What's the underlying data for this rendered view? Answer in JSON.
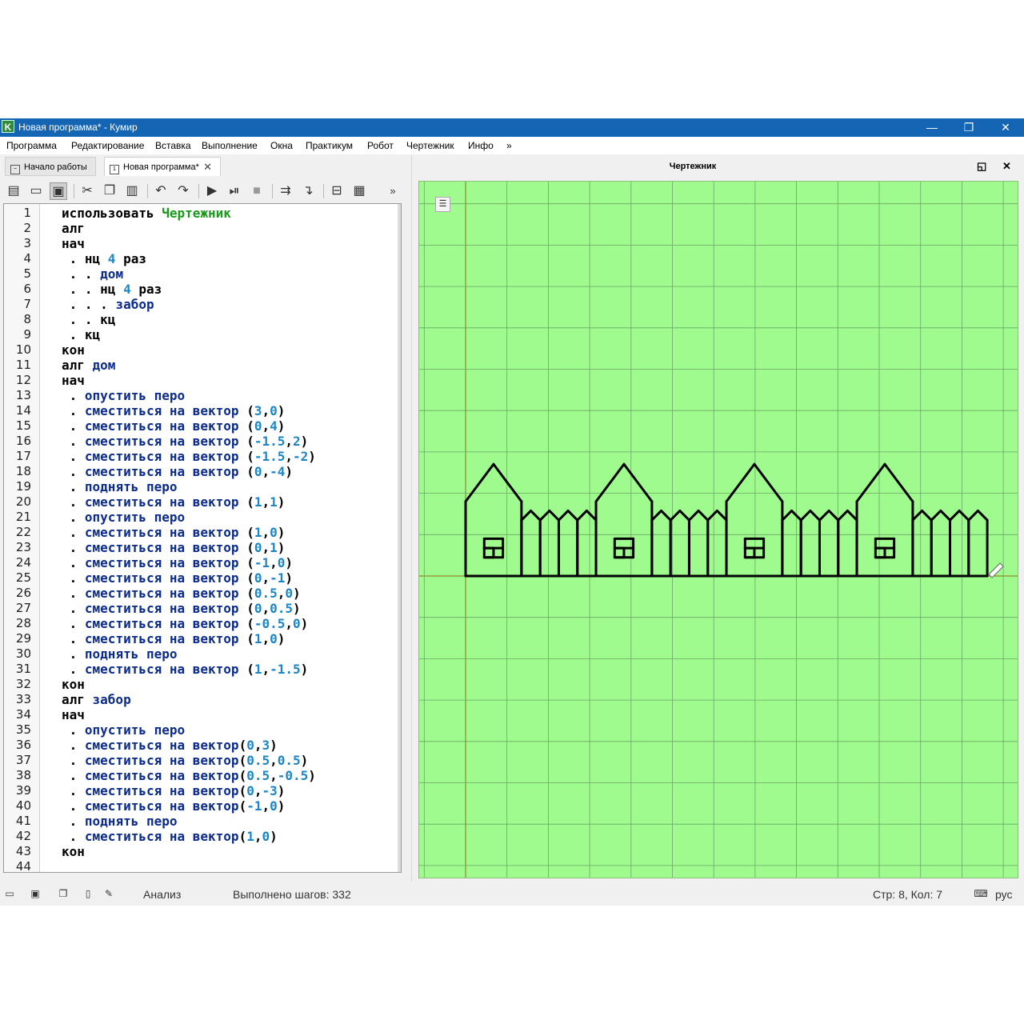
{
  "window": {
    "title": "Новая программа* - Кумир",
    "app_icon": "K",
    "controls": {
      "minimize": "—",
      "restore": "❐",
      "close": "✕"
    }
  },
  "menu": [
    "Программа",
    "Редактирование",
    "Вставка",
    "Выполнение",
    "Окна",
    "Практикум",
    "Робот",
    "Чертежник",
    "Инфо",
    "»"
  ],
  "tabs": [
    {
      "label": "Начало работы",
      "icon": "start-page-icon"
    },
    {
      "label": "Новая программа*",
      "icon": "document-icon",
      "close": "✕"
    }
  ],
  "toolbar": {
    "icons": [
      "new-file-icon",
      "open-folder-icon",
      "save-icon",
      "cut-icon",
      "copy-icon",
      "paste-icon",
      "undo-icon",
      "redo-icon",
      "run-icon",
      "run-step-icon",
      "stop-icon",
      "step-over-icon",
      "step-into-icon",
      "debug-mode-icon",
      "grid-view-icon"
    ],
    "overflow": "»"
  },
  "code": [
    {
      "n": "1",
      "t": [
        [
          "k",
          "использовать "
        ],
        [
          "m",
          "Чертежник"
        ]
      ]
    },
    {
      "n": "2",
      "t": [
        [
          "k",
          "алг"
        ]
      ]
    },
    {
      "n": "3",
      "t": [
        [
          "k",
          "нач"
        ]
      ]
    },
    {
      "n": "4",
      "t": [
        [
          "k",
          " . нц "
        ],
        [
          "n",
          "4"
        ],
        [
          "k",
          " раз"
        ]
      ]
    },
    {
      "n": "5",
      "t": [
        [
          "k",
          " . . "
        ],
        [
          "p",
          "дом"
        ]
      ]
    },
    {
      "n": "6",
      "t": [
        [
          "k",
          " . . нц "
        ],
        [
          "n",
          "4"
        ],
        [
          "k",
          " раз"
        ]
      ]
    },
    {
      "n": "7",
      "t": [
        [
          "k",
          " . . . "
        ],
        [
          "p",
          "забор"
        ]
      ]
    },
    {
      "n": "8",
      "t": [
        [
          "k",
          " . . кц"
        ]
      ]
    },
    {
      "n": "9",
      "t": [
        [
          "k",
          " . кц"
        ]
      ]
    },
    {
      "n": "10",
      "t": [
        [
          "k",
          "кон"
        ]
      ]
    },
    {
      "n": "11",
      "t": [
        [
          "k",
          "алг "
        ],
        [
          "p",
          "дом"
        ]
      ]
    },
    {
      "n": "12",
      "t": [
        [
          "k",
          "нач"
        ]
      ]
    },
    {
      "n": "13",
      "t": [
        [
          "k",
          " . "
        ],
        [
          "p",
          "опустить перо"
        ]
      ]
    },
    {
      "n": "14",
      "t": [
        [
          "k",
          " . "
        ],
        [
          "p",
          "сместиться на вектор "
        ],
        [
          "k",
          "("
        ],
        [
          "n",
          "3"
        ],
        [
          "k",
          ","
        ],
        [
          "n",
          "0"
        ],
        [
          "k",
          ")"
        ]
      ]
    },
    {
      "n": "15",
      "t": [
        [
          "k",
          " . "
        ],
        [
          "p",
          "сместиться на вектор "
        ],
        [
          "k",
          "("
        ],
        [
          "n",
          "0"
        ],
        [
          "k",
          ","
        ],
        [
          "n",
          "4"
        ],
        [
          "k",
          ")"
        ]
      ]
    },
    {
      "n": "16",
      "t": [
        [
          "k",
          " . "
        ],
        [
          "p",
          "сместиться на вектор "
        ],
        [
          "k",
          "("
        ],
        [
          "n",
          "-1.5"
        ],
        [
          "k",
          ","
        ],
        [
          "n",
          "2"
        ],
        [
          "k",
          ")"
        ]
      ]
    },
    {
      "n": "17",
      "t": [
        [
          "k",
          " . "
        ],
        [
          "p",
          "сместиться на вектор "
        ],
        [
          "k",
          "("
        ],
        [
          "n",
          "-1.5"
        ],
        [
          "k",
          ","
        ],
        [
          "n",
          "-2"
        ],
        [
          "k",
          ")"
        ]
      ]
    },
    {
      "n": "18",
      "t": [
        [
          "k",
          " . "
        ],
        [
          "p",
          "сместиться на вектор "
        ],
        [
          "k",
          "("
        ],
        [
          "n",
          "0"
        ],
        [
          "k",
          ","
        ],
        [
          "n",
          "-4"
        ],
        [
          "k",
          ")"
        ]
      ]
    },
    {
      "n": "19",
      "t": [
        [
          "k",
          " . "
        ],
        [
          "p",
          "поднять перо"
        ]
      ]
    },
    {
      "n": "20",
      "t": [
        [
          "k",
          " . "
        ],
        [
          "p",
          "сместиться на вектор "
        ],
        [
          "k",
          "("
        ],
        [
          "n",
          "1"
        ],
        [
          "k",
          ","
        ],
        [
          "n",
          "1"
        ],
        [
          "k",
          ")"
        ]
      ]
    },
    {
      "n": "21",
      "t": [
        [
          "k",
          " . "
        ],
        [
          "p",
          "опустить перо"
        ]
      ]
    },
    {
      "n": "22",
      "t": [
        [
          "k",
          " . "
        ],
        [
          "p",
          "сместиться на вектор "
        ],
        [
          "k",
          "("
        ],
        [
          "n",
          "1"
        ],
        [
          "k",
          ","
        ],
        [
          "n",
          "0"
        ],
        [
          "k",
          ")"
        ]
      ]
    },
    {
      "n": "23",
      "t": [
        [
          "k",
          " . "
        ],
        [
          "p",
          "сместиться на вектор "
        ],
        [
          "k",
          "("
        ],
        [
          "n",
          "0"
        ],
        [
          "k",
          ","
        ],
        [
          "n",
          "1"
        ],
        [
          "k",
          ")"
        ]
      ]
    },
    {
      "n": "24",
      "t": [
        [
          "k",
          " . "
        ],
        [
          "p",
          "сместиться на вектор "
        ],
        [
          "k",
          "("
        ],
        [
          "n",
          "-1"
        ],
        [
          "k",
          ","
        ],
        [
          "n",
          "0"
        ],
        [
          "k",
          ")"
        ]
      ]
    },
    {
      "n": "25",
      "t": [
        [
          "k",
          " . "
        ],
        [
          "p",
          "сместиться на вектор "
        ],
        [
          "k",
          "("
        ],
        [
          "n",
          "0"
        ],
        [
          "k",
          ","
        ],
        [
          "n",
          "-1"
        ],
        [
          "k",
          ")"
        ]
      ]
    },
    {
      "n": "26",
      "t": [
        [
          "k",
          " . "
        ],
        [
          "p",
          "сместиться на вектор "
        ],
        [
          "k",
          "("
        ],
        [
          "n",
          "0.5"
        ],
        [
          "k",
          ","
        ],
        [
          "n",
          "0"
        ],
        [
          "k",
          ")"
        ]
      ]
    },
    {
      "n": "27",
      "t": [
        [
          "k",
          " . "
        ],
        [
          "p",
          "сместиться на вектор "
        ],
        [
          "k",
          "("
        ],
        [
          "n",
          "0"
        ],
        [
          "k",
          ","
        ],
        [
          "n",
          "0.5"
        ],
        [
          "k",
          ")"
        ]
      ]
    },
    {
      "n": "28",
      "t": [
        [
          "k",
          " . "
        ],
        [
          "p",
          "сместиться на вектор "
        ],
        [
          "k",
          "("
        ],
        [
          "n",
          "-0.5"
        ],
        [
          "k",
          ","
        ],
        [
          "n",
          "0"
        ],
        [
          "k",
          ")"
        ]
      ]
    },
    {
      "n": "29",
      "t": [
        [
          "k",
          " . "
        ],
        [
          "p",
          "сместиться на вектор "
        ],
        [
          "k",
          "("
        ],
        [
          "n",
          "1"
        ],
        [
          "k",
          ","
        ],
        [
          "n",
          "0"
        ],
        [
          "k",
          ")"
        ]
      ]
    },
    {
      "n": "30",
      "t": [
        [
          "k",
          " . "
        ],
        [
          "p",
          "поднять перо"
        ]
      ]
    },
    {
      "n": "31",
      "t": [
        [
          "k",
          " . "
        ],
        [
          "p",
          "сместиться на вектор "
        ],
        [
          "k",
          "("
        ],
        [
          "n",
          "1"
        ],
        [
          "k",
          ","
        ],
        [
          "n",
          "-1.5"
        ],
        [
          "k",
          ")"
        ]
      ]
    },
    {
      "n": "32",
      "t": [
        [
          "k",
          "кон"
        ]
      ]
    },
    {
      "n": "33",
      "t": [
        [
          "k",
          "алг "
        ],
        [
          "p",
          "забор"
        ]
      ]
    },
    {
      "n": "34",
      "t": [
        [
          "k",
          "нач"
        ]
      ]
    },
    {
      "n": "35",
      "t": [
        [
          "k",
          " . "
        ],
        [
          "p",
          "опустить перо"
        ]
      ]
    },
    {
      "n": "36",
      "t": [
        [
          "k",
          " . "
        ],
        [
          "p",
          "сместиться на вектор"
        ],
        [
          "k",
          "("
        ],
        [
          "n",
          "0"
        ],
        [
          "k",
          ","
        ],
        [
          "n",
          "3"
        ],
        [
          "k",
          ")"
        ]
      ]
    },
    {
      "n": "37",
      "t": [
        [
          "k",
          " . "
        ],
        [
          "p",
          "сместиться на вектор"
        ],
        [
          "k",
          "("
        ],
        [
          "n",
          "0.5"
        ],
        [
          "k",
          ","
        ],
        [
          "n",
          "0.5"
        ],
        [
          "k",
          ")"
        ]
      ]
    },
    {
      "n": "38",
      "t": [
        [
          "k",
          " . "
        ],
        [
          "p",
          "сместиться на вектор"
        ],
        [
          "k",
          "("
        ],
        [
          "n",
          "0.5"
        ],
        [
          "k",
          ","
        ],
        [
          "n",
          "-0.5"
        ],
        [
          "k",
          ")"
        ]
      ]
    },
    {
      "n": "39",
      "t": [
        [
          "k",
          " . "
        ],
        [
          "p",
          "сместиться на вектор"
        ],
        [
          "k",
          "("
        ],
        [
          "n",
          "0"
        ],
        [
          "k",
          ","
        ],
        [
          "n",
          "-3"
        ],
        [
          "k",
          ")"
        ]
      ]
    },
    {
      "n": "40",
      "t": [
        [
          "k",
          " . "
        ],
        [
          "p",
          "сместиться на вектор"
        ],
        [
          "k",
          "("
        ],
        [
          "n",
          "-1"
        ],
        [
          "k",
          ","
        ],
        [
          "n",
          "0"
        ],
        [
          "k",
          ")"
        ]
      ]
    },
    {
      "n": "41",
      "t": [
        [
          "k",
          " . "
        ],
        [
          "p",
          "поднять перо"
        ]
      ]
    },
    {
      "n": "42",
      "t": [
        [
          "k",
          " . "
        ],
        [
          "p",
          "сместиться на вектор"
        ],
        [
          "k",
          "("
        ],
        [
          "n",
          "1"
        ],
        [
          "k",
          ","
        ],
        [
          "n",
          "0"
        ],
        [
          "k",
          ")"
        ]
      ]
    },
    {
      "n": "43",
      "t": [
        [
          "k",
          "кон"
        ]
      ]
    },
    {
      "n": "44",
      "t": []
    }
  ],
  "drawer_panel": {
    "title": "Чертежник",
    "colors": {
      "background": "#a0fb8e",
      "grid": "#6aa566",
      "axis": "#8e8a2a",
      "pen": "#000000"
    },
    "menu_icon": "☰",
    "float_icon": "◱",
    "close_icon": "✕"
  },
  "status": {
    "analysis": "Анализ",
    "steps": "Выполнено шагов: 332",
    "position": "Стр: 8, Кол: 7",
    "language": "рус",
    "icons": [
      "console-icon",
      "save-output-icon",
      "copy-output-icon",
      "clear-output-icon",
      "edit-icon",
      "keyboard-icon"
    ]
  }
}
